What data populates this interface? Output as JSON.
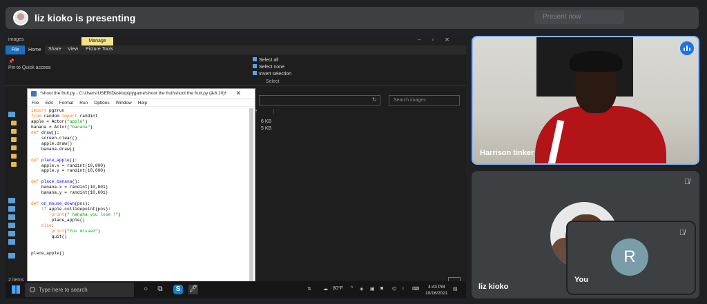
{
  "meeting": {
    "presenter_banner": "liz kioko is presenting",
    "ghost_control": "Present now"
  },
  "explorer": {
    "title": "images",
    "manage_tab": "Manage",
    "tabs": [
      "File",
      "Home",
      "Share",
      "View",
      "Picture Tools"
    ],
    "pin_label": "Pin to Quick access",
    "select_items": [
      "Select all",
      "Select none",
      "Invert selection"
    ],
    "select_group_label": "Select",
    "search_placeholder": "Search images",
    "col_size": "ze",
    "sizes": [
      "6 KB",
      "5 KB"
    ],
    "status": "2 items"
  },
  "idle": {
    "title": "*shoot the fruit.py - C:\\Users\\USER\\Desktop\\pygame\\shoot the fruit\\shoot the fruit.py (3.8.10)*",
    "menu": [
      "File",
      "Edit",
      "Format",
      "Run",
      "Options",
      "Window",
      "Help"
    ]
  },
  "taskbar": {
    "search_placeholder": "Type here to search",
    "weather": "80°F",
    "time": "4:43 PM",
    "date": "10/16/2021"
  },
  "participants": {
    "harrison": {
      "name": "Harrison tinker"
    },
    "liz": {
      "name": "liz kioko"
    },
    "self": {
      "name": "You",
      "initial": "R"
    }
  },
  "colors": {
    "meet_bg": "#202124",
    "tile_bg": "#3c4043",
    "active_border": "#8ab4f8",
    "speaking": "#1a73e8"
  }
}
